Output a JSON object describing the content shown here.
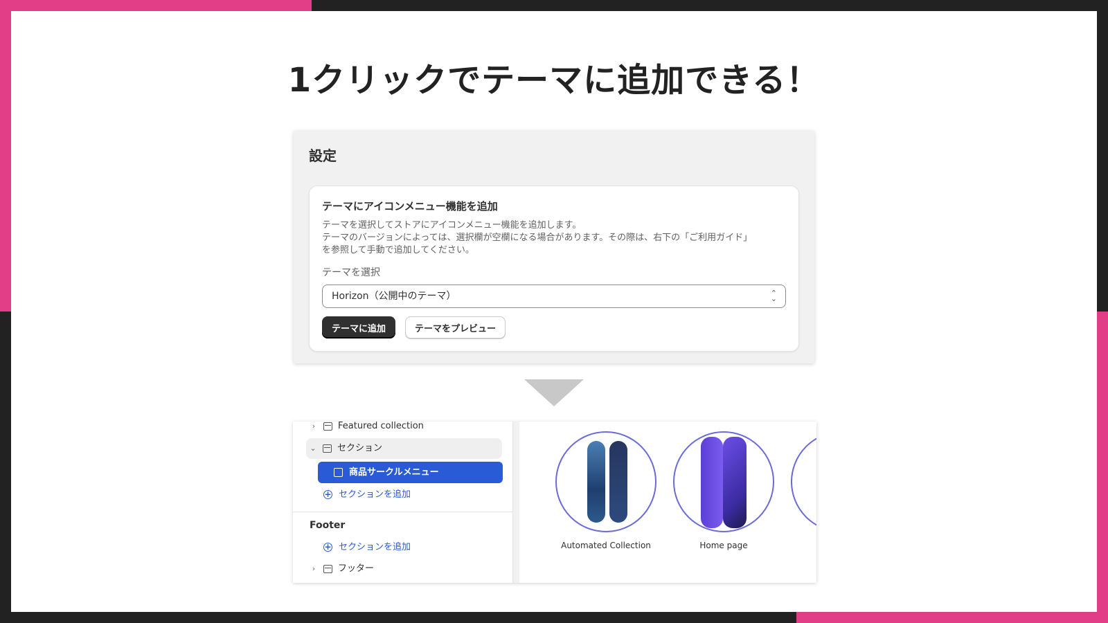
{
  "headline": "1クリックでテーマに追加できる！",
  "settings": {
    "title": "設定",
    "card_title": "テーマにアイコンメニュー機能を追加",
    "description": [
      "テーマを選択してストアにアイコンメニュー機能を追加します。",
      "テーマのバージョンによっては、選択欄が空欄になる場合があります。その際は、右下の「ご利用ガイド」",
      "を参照して手動で追加してください。"
    ],
    "select_label": "テーマを選択",
    "select_value": "Horizon（公開中のテーマ）",
    "add_button": "テーマに追加",
    "preview_button": "テーマをプレビュー"
  },
  "editor": {
    "tree": {
      "featured_collection": "Featured collection",
      "section": "セクション",
      "selected_item": "商品サークルメニュー",
      "add_section": "セクションを追加",
      "footer_heading": "Footer",
      "footer_add_section": "セクションを追加",
      "footer_item": "フッター"
    },
    "preview": {
      "items": [
        "Automated Collection",
        "Home page"
      ]
    }
  },
  "colors": {
    "accent_pink": "#e23e87",
    "dark": "#222222",
    "link_blue": "#2a5bd7"
  }
}
